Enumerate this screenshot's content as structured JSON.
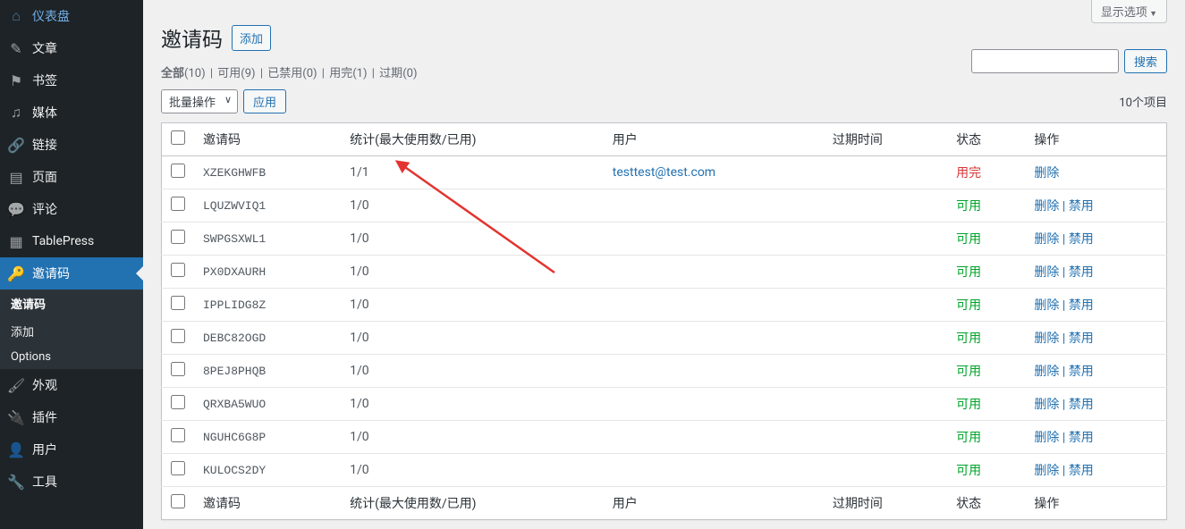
{
  "sidebar": {
    "items": [
      {
        "label": "仪表盘",
        "icon": "dashboard"
      },
      {
        "label": "文章",
        "icon": "post"
      },
      {
        "label": "书签",
        "icon": "bookmark"
      },
      {
        "label": "媒体",
        "icon": "media"
      },
      {
        "label": "链接",
        "icon": "link"
      },
      {
        "label": "页面",
        "icon": "page"
      },
      {
        "label": "评论",
        "icon": "comment"
      },
      {
        "label": "TablePress",
        "icon": "table"
      },
      {
        "label": "邀请码",
        "icon": "key",
        "active": true
      },
      {
        "label": "外观",
        "icon": "appearance"
      },
      {
        "label": "插件",
        "icon": "plugin"
      },
      {
        "label": "用户",
        "icon": "user"
      },
      {
        "label": "工具",
        "icon": "tool"
      }
    ],
    "sub": [
      {
        "label": "邀请码",
        "current": true
      },
      {
        "label": "添加"
      },
      {
        "label": "Options"
      }
    ]
  },
  "screenOptions": "显示选项",
  "pageTitle": "邀请码",
  "addBtn": "添加",
  "filters": {
    "all": "全部",
    "allCount": "(10)",
    "available": "可用",
    "availableCount": "(9)",
    "disabled": "已禁用",
    "disabledCount": "(0)",
    "used": "用完",
    "usedCount": "(1)",
    "expired": "过期",
    "expiredCount": "(0)"
  },
  "bulkAction": "批量操作",
  "applyBtn": "应用",
  "searchBtn": "搜索",
  "countText": "10个项目",
  "columns": {
    "code": "邀请码",
    "stats": "统计(最大使用数/已用)",
    "user": "用户",
    "expire": "过期时间",
    "status": "状态",
    "action": "操作"
  },
  "statusLabels": {
    "used": "用完",
    "ok": "可用"
  },
  "actionLabels": {
    "delete": "删除",
    "disable": "禁用"
  },
  "rows": [
    {
      "code": "XZEKGHWFB",
      "stats": "1/1",
      "user": "testtest@test.com",
      "expire": "",
      "status": "used",
      "actions": [
        "delete"
      ]
    },
    {
      "code": "LQUZWVIQ1",
      "stats": "1/0",
      "user": "",
      "expire": "",
      "status": "ok",
      "actions": [
        "delete",
        "disable"
      ]
    },
    {
      "code": "SWPGSXWL1",
      "stats": "1/0",
      "user": "",
      "expire": "",
      "status": "ok",
      "actions": [
        "delete",
        "disable"
      ]
    },
    {
      "code": "PX0DXAURH",
      "stats": "1/0",
      "user": "",
      "expire": "",
      "status": "ok",
      "actions": [
        "delete",
        "disable"
      ]
    },
    {
      "code": "IPPLIDG8Z",
      "stats": "1/0",
      "user": "",
      "expire": "",
      "status": "ok",
      "actions": [
        "delete",
        "disable"
      ]
    },
    {
      "code": "DEBC82OGD",
      "stats": "1/0",
      "user": "",
      "expire": "",
      "status": "ok",
      "actions": [
        "delete",
        "disable"
      ]
    },
    {
      "code": "8PEJ8PHQB",
      "stats": "1/0",
      "user": "",
      "expire": "",
      "status": "ok",
      "actions": [
        "delete",
        "disable"
      ]
    },
    {
      "code": "QRXBA5WUO",
      "stats": "1/0",
      "user": "",
      "expire": "",
      "status": "ok",
      "actions": [
        "delete",
        "disable"
      ]
    },
    {
      "code": "NGUHC6G8P",
      "stats": "1/0",
      "user": "",
      "expire": "",
      "status": "ok",
      "actions": [
        "delete",
        "disable"
      ]
    },
    {
      "code": "KULOCS2DY",
      "stats": "1/0",
      "user": "",
      "expire": "",
      "status": "ok",
      "actions": [
        "delete",
        "disable"
      ]
    }
  ]
}
